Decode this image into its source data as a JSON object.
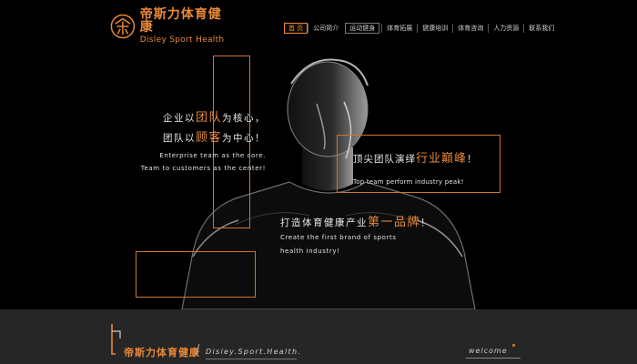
{
  "logo": {
    "cn": "帝斯力体育健康",
    "en": "Disley Sport Health"
  },
  "nav": {
    "items": [
      {
        "label": "首 页",
        "state": "active"
      },
      {
        "label": "公司简介",
        "state": ""
      },
      {
        "label": "运动健身",
        "state": "boxed"
      },
      {
        "label": "体育拓展",
        "state": ""
      },
      {
        "label": "健康培训",
        "state": ""
      },
      {
        "label": "体育咨询",
        "state": ""
      },
      {
        "label": "人力资源",
        "state": ""
      },
      {
        "label": "联系我们",
        "state": ""
      }
    ]
  },
  "hero": {
    "slogan1": {
      "line1_pre": "企业以",
      "line1_hl": "团队",
      "line1_post": "为核心，",
      "line2_pre": "团队以",
      "line2_hl": "顾客",
      "line2_post": "为中心！",
      "en1": "Enterprise team as the core.",
      "en2": "Team to customers as the center!"
    },
    "slogan2": {
      "cn_pre": "顶尖团队演绎",
      "cn_hl": "行业巅峰",
      "cn_post": "！",
      "en": "Top team perform industry peak!"
    },
    "slogan3": {
      "cn_pre": "打造体育健康产业",
      "cn_hl": "第一品牌",
      "cn_post": "！",
      "en1": "Create the first brand of sports",
      "en2": "health industry!"
    }
  },
  "footer": {
    "cn": "帝斯力体育健康",
    "slash": "/",
    "en": "Disley.Sport.Health.",
    "welcome": "welcome"
  },
  "colors": {
    "accent": "#e8893a",
    "background": "#000000",
    "footer_bg": "#262626"
  }
}
